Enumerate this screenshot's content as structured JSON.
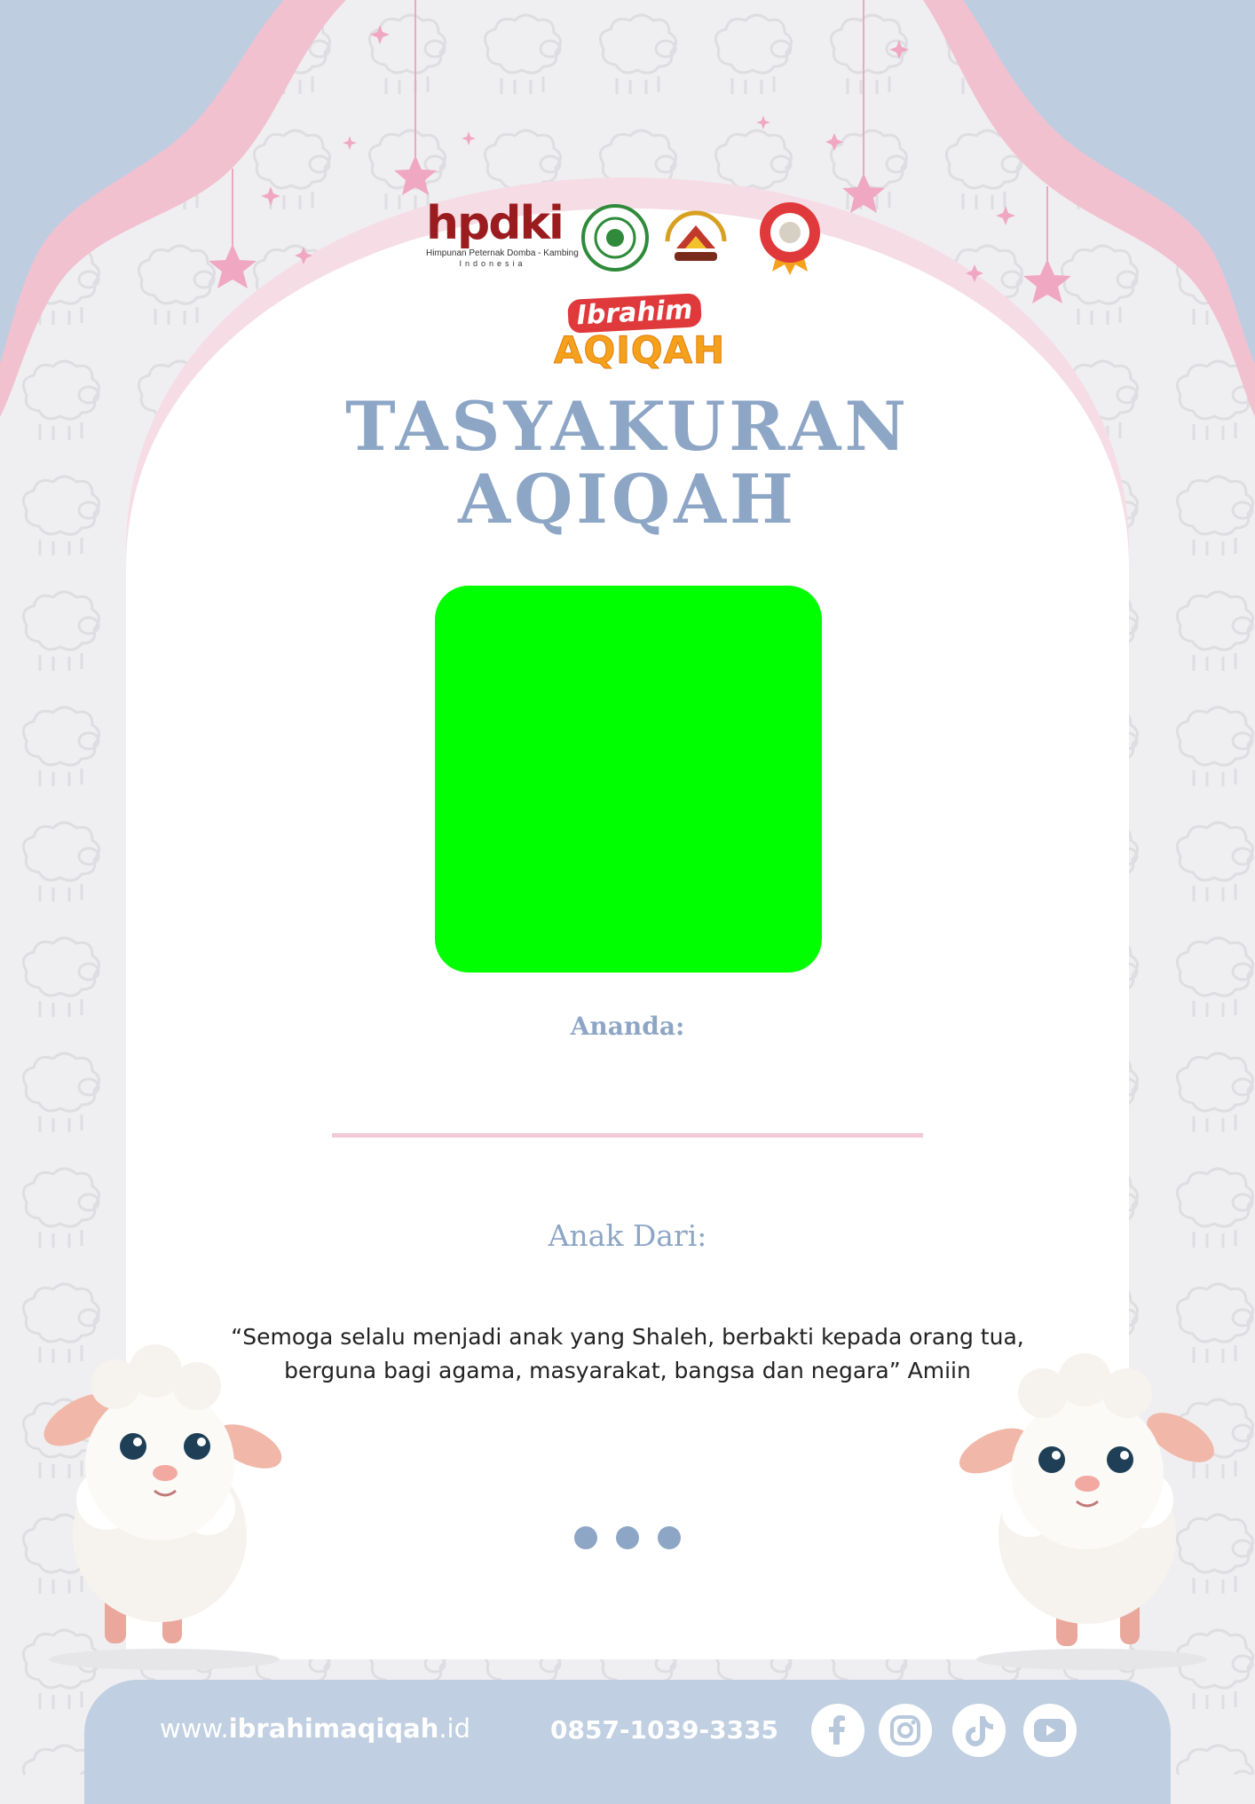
{
  "logos": {
    "hpdki_word": "hpdki",
    "hpdki_sub": "Himpunan Peternak Domba - Kambing",
    "hpdki_country": "Indonesia",
    "icons": [
      "mui-seal-icon",
      "association-emblem-icon",
      "quality-badge-icon"
    ]
  },
  "brand": {
    "top": "Ibrahim",
    "bottom": "AQIQAH"
  },
  "title": {
    "line1": "TASYAKURAN",
    "line2": "AQIQAH"
  },
  "photo_placeholder_color": "#00ff00",
  "ananda_label": "Ananda:",
  "anak_dari_label": "Anak Dari:",
  "quote": {
    "line1": "“Semoga selalu menjadi anak yang Shaleh, berbakti kepada orang tua,",
    "line2": "berguna bagi agama, masyarakat, bangsa dan negara” Amiin"
  },
  "footer": {
    "website_prefix": "www.",
    "website_bold": "ibrahimaqiqah",
    "website_suffix": ".id",
    "phone": "0857-1039-3335",
    "social_icons": [
      "facebook-icon",
      "instagram-icon",
      "tiktok-icon",
      "youtube-icon"
    ]
  },
  "colors": {
    "accent_blue": "#8ea6c6",
    "pink": "#f4c9d6",
    "footer_bg": "#c0cfe1",
    "brand_red": "#e0393b",
    "brand_orange": "#f5a11c"
  }
}
